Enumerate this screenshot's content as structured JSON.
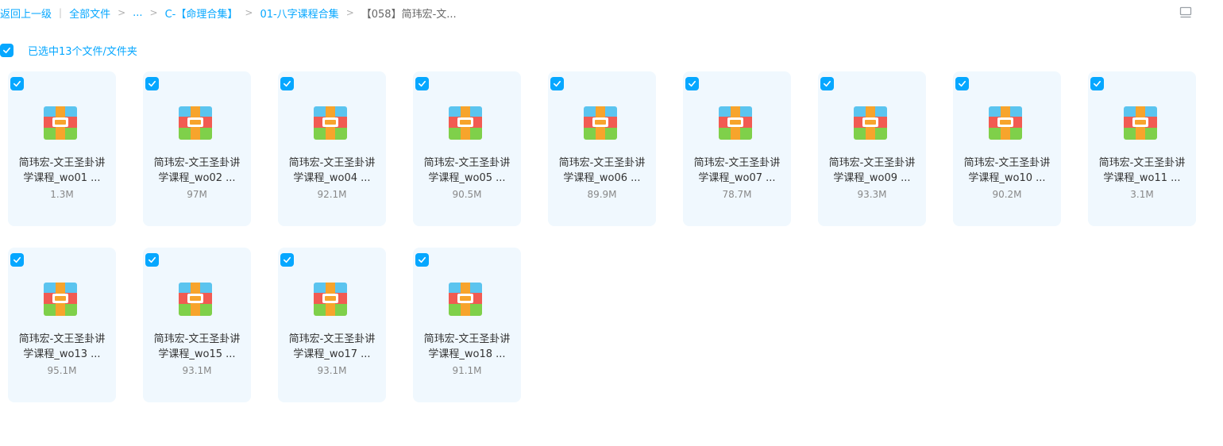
{
  "breadcrumb": {
    "back": "返回上一级",
    "all_files": "全部文件",
    "ellipsis": "...",
    "crumbs": [
      "C-【命理合集】",
      "01-八字课程合集"
    ],
    "current": "【058】简玮宏-文..."
  },
  "selection": {
    "label": "已选中13个文件/文件夹"
  },
  "files": [
    {
      "line1": "简玮宏-文王圣卦讲",
      "line2": "学课程_wo01 ...",
      "size": "1.3M"
    },
    {
      "line1": "简玮宏-文王圣卦讲",
      "line2": "学课程_wo02 ...",
      "size": "97M"
    },
    {
      "line1": "简玮宏-文王圣卦讲",
      "line2": "学课程_wo04 ...",
      "size": "92.1M"
    },
    {
      "line1": "简玮宏-文王圣卦讲",
      "line2": "学课程_wo05 ...",
      "size": "90.5M"
    },
    {
      "line1": "简玮宏-文王圣卦讲",
      "line2": "学课程_wo06 ...",
      "size": "89.9M"
    },
    {
      "line1": "简玮宏-文王圣卦讲",
      "line2": "学课程_wo07 ...",
      "size": "78.7M"
    },
    {
      "line1": "简玮宏-文王圣卦讲",
      "line2": "学课程_wo09 ...",
      "size": "93.3M"
    },
    {
      "line1": "简玮宏-文王圣卦讲",
      "line2": "学课程_wo10 ...",
      "size": "90.2M"
    },
    {
      "line1": "简玮宏-文王圣卦讲",
      "line2": "学课程_wo11 ...",
      "size": "3.1M"
    },
    {
      "line1": "简玮宏-文王圣卦讲",
      "line2": "学课程_wo13 ...",
      "size": "95.1M"
    },
    {
      "line1": "简玮宏-文王圣卦讲",
      "line2": "学课程_wo15 ...",
      "size": "93.1M"
    },
    {
      "line1": "简玮宏-文王圣卦讲",
      "line2": "学课程_wo17 ...",
      "size": "93.1M"
    },
    {
      "line1": "简玮宏-文王圣卦讲",
      "line2": "学课程_wo18 ...",
      "size": "91.1M"
    }
  ],
  "icons": {
    "file_type": "archive-zip-icon",
    "checkbox": "checkmark-icon",
    "view_toggle": "list-view-icon"
  },
  "colors": {
    "accent": "#06a7ff",
    "card_bg": "#f0f8fe"
  }
}
